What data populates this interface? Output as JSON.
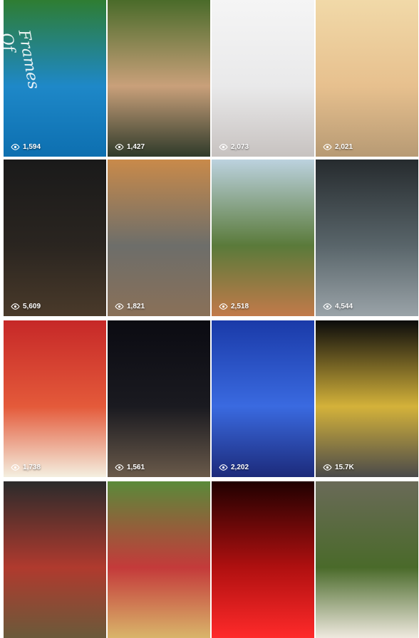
{
  "reels": [
    {
      "views": "1,594",
      "colors": [
        "#2e7d32",
        "#1e88c8",
        "#0d6fb0"
      ]
    },
    {
      "views": "1,427",
      "colors": [
        "#4a6b2a",
        "#c9a07a",
        "#2f3a2a"
      ]
    },
    {
      "views": "2,073",
      "colors": [
        "#f5f5f5",
        "#e9e9ea",
        "#c7c2c0"
      ]
    },
    {
      "views": "2,021",
      "colors": [
        "#f1d9a8",
        "#e7c08e",
        "#b79a74"
      ]
    },
    {
      "views": "5,609",
      "colors": [
        "#1a1a1a",
        "#2a2520",
        "#4a3a2a"
      ]
    },
    {
      "views": "1,821",
      "colors": [
        "#c98a4a",
        "#6d6e6a",
        "#8a7058"
      ]
    },
    {
      "views": "2,518",
      "colors": [
        "#bcd2df",
        "#5a7a3a",
        "#c27a4a"
      ]
    },
    {
      "views": "4,544",
      "colors": [
        "#262b2e",
        "#59656a",
        "#9aa3a8"
      ]
    },
    {
      "views": "1,738",
      "colors": [
        "#c62828",
        "#e45a3a",
        "#f4efe0"
      ]
    },
    {
      "views": "1,561",
      "colors": [
        "#0b0b12",
        "#1a1a20",
        "#6a5a4a"
      ]
    },
    {
      "views": "2,202",
      "colors": [
        "#1a3aa8",
        "#3a6ae0",
        "#1c2a7a"
      ]
    },
    {
      "views": "15.7K",
      "colors": [
        "#0b0b0b",
        "#d4b23a",
        "#4a4a4a"
      ]
    },
    {
      "views": "",
      "colors": [
        "#2b2b2b",
        "#b03a2e",
        "#6a5a3a"
      ]
    },
    {
      "views": "",
      "colors": [
        "#5a8a3a",
        "#c43a3a",
        "#d9b56a"
      ]
    },
    {
      "views": "",
      "colors": [
        "#200000",
        "#b01010",
        "#ff2a2a"
      ]
    },
    {
      "views": "",
      "colors": [
        "#6a6a58",
        "#4a6a2a",
        "#efe9df"
      ]
    }
  ],
  "watermark": "Frames Of"
}
